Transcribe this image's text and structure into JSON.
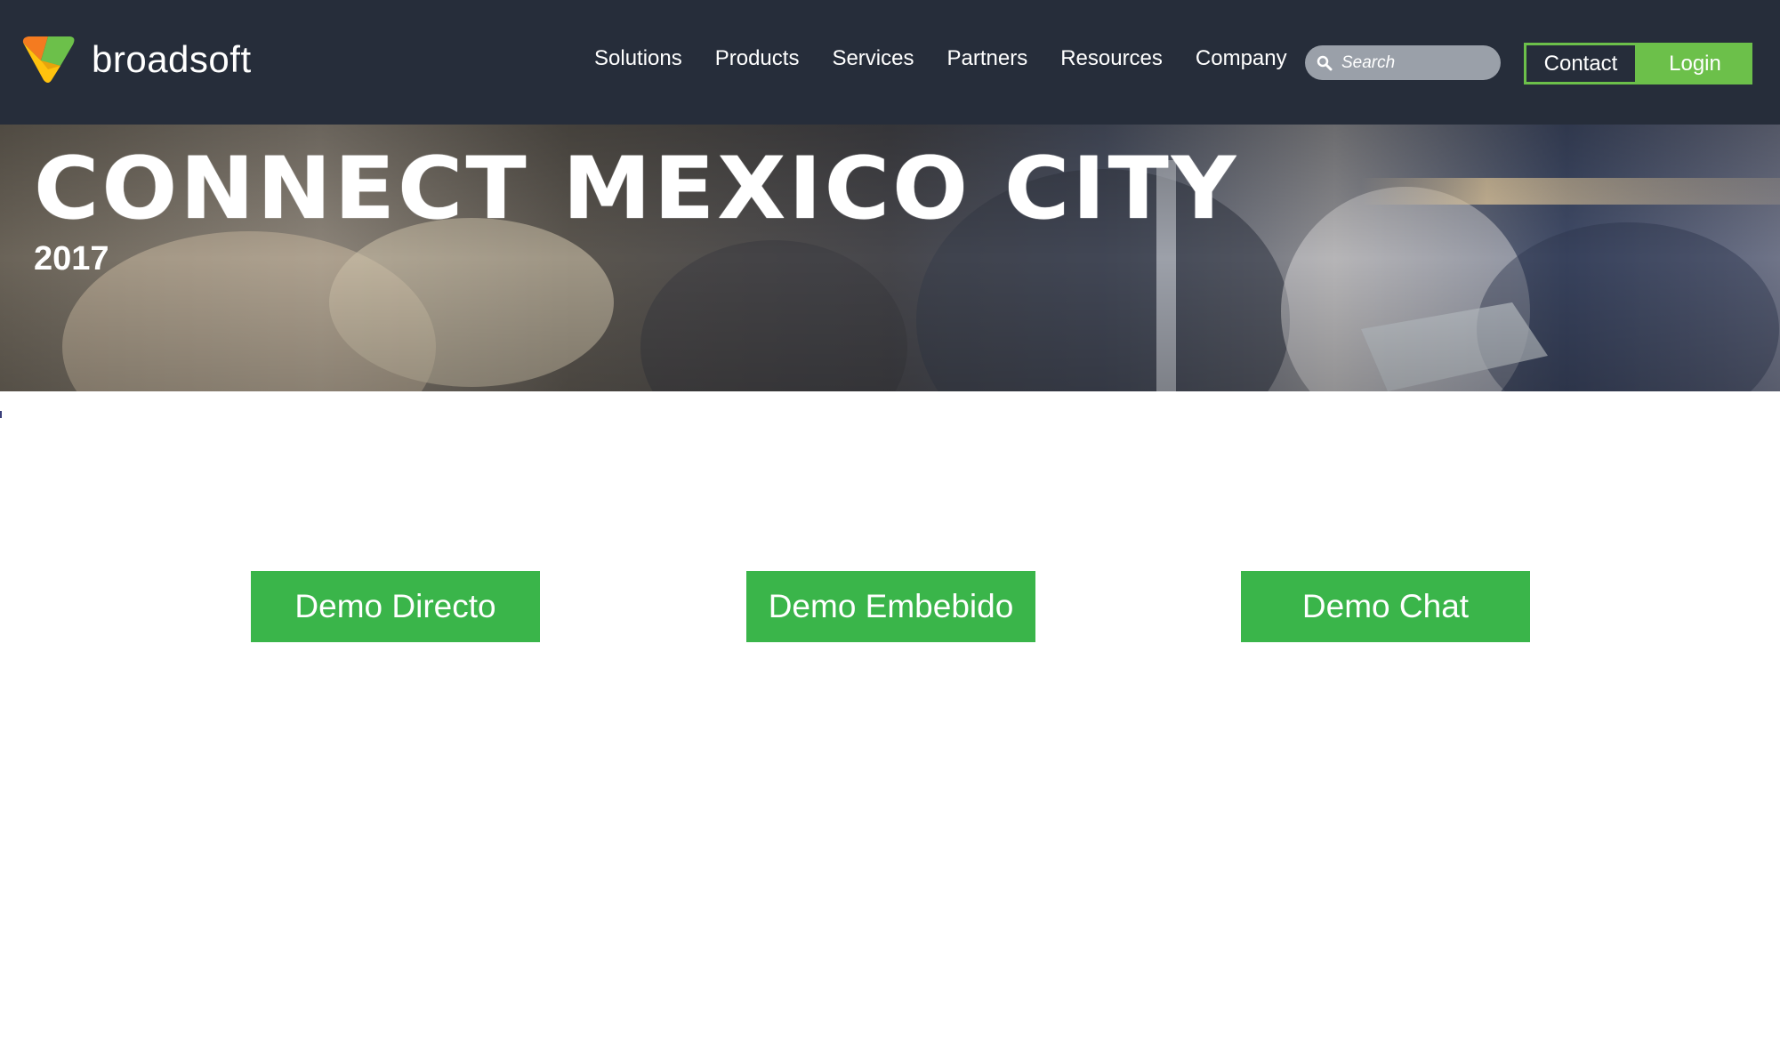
{
  "header": {
    "logo_text": "broadsoft",
    "nav_items": [
      "Solutions",
      "Products",
      "Services",
      "Partners",
      "Resources",
      "Company"
    ],
    "search": {
      "placeholder": "Search"
    },
    "contact_label": "Contact",
    "login_label": "Login",
    "colors": {
      "bar": "#262d3a",
      "accent": "#6cc04a"
    }
  },
  "hero": {
    "title": "CONNECT MEXICO CITY",
    "year": "2017"
  },
  "demos": {
    "buttons": [
      "Demo Directo",
      "Demo Embebido",
      "Demo Chat"
    ],
    "color": "#3ab54a"
  }
}
